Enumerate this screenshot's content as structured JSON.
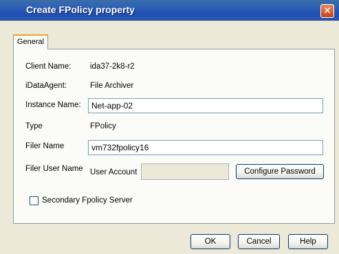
{
  "window": {
    "title": "Create FPolicy property",
    "close_glyph": "✕"
  },
  "tabs": [
    {
      "label": "General"
    }
  ],
  "fields": {
    "client_name": {
      "label": "Client Name:",
      "value": "ida37-2k8-r2"
    },
    "idataagent": {
      "label": "iDataAgent:",
      "value": "File Archiver"
    },
    "instance_name": {
      "label": "Instance Name:",
      "value": "Net-app-02"
    },
    "type": {
      "label": "Type",
      "value": "FPolicy"
    },
    "filer_name": {
      "label": "Filer Name",
      "value": "vm732fpolicy16"
    },
    "filer_user_name": {
      "label": "Filer User Name",
      "sub_label": "User Account",
      "value": "",
      "button_label": "Configure Password"
    },
    "secondary_server": {
      "label": "Secondary Fpolicy Server",
      "checked": false
    }
  },
  "footer": {
    "ok_label": "OK",
    "cancel_label": "Cancel",
    "help_label": "Help"
  },
  "colors": {
    "title_bar": "#2454b4",
    "tab_accent": "#f0a028",
    "close_button": "#d4502a"
  },
  "icons": {
    "close": "close-icon"
  }
}
